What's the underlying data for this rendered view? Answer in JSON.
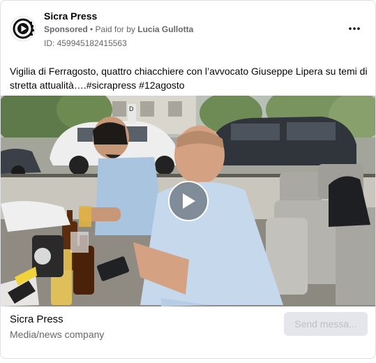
{
  "post": {
    "page_name": "Sicra Press",
    "sponsored_label": "Sponsored",
    "separator": " • ",
    "paid_for_prefix": "Paid for by ",
    "paid_for_name": "Lucia Gullotta",
    "ad_id": "ID: 459945182415563",
    "more_icon": "more-horizontal-icon",
    "caption": "Vigilia di Ferragosto, quattro chiacchiere con l’avvocato Giuseppe Lipera su temi di stretta attualità….#sicrapress #12agosto"
  },
  "video": {
    "play_icon": "play-icon",
    "sign_letter": "D"
  },
  "footer": {
    "page_name": "Sicra Press",
    "category": "Media/news company",
    "cta_label": "Send messa..."
  }
}
